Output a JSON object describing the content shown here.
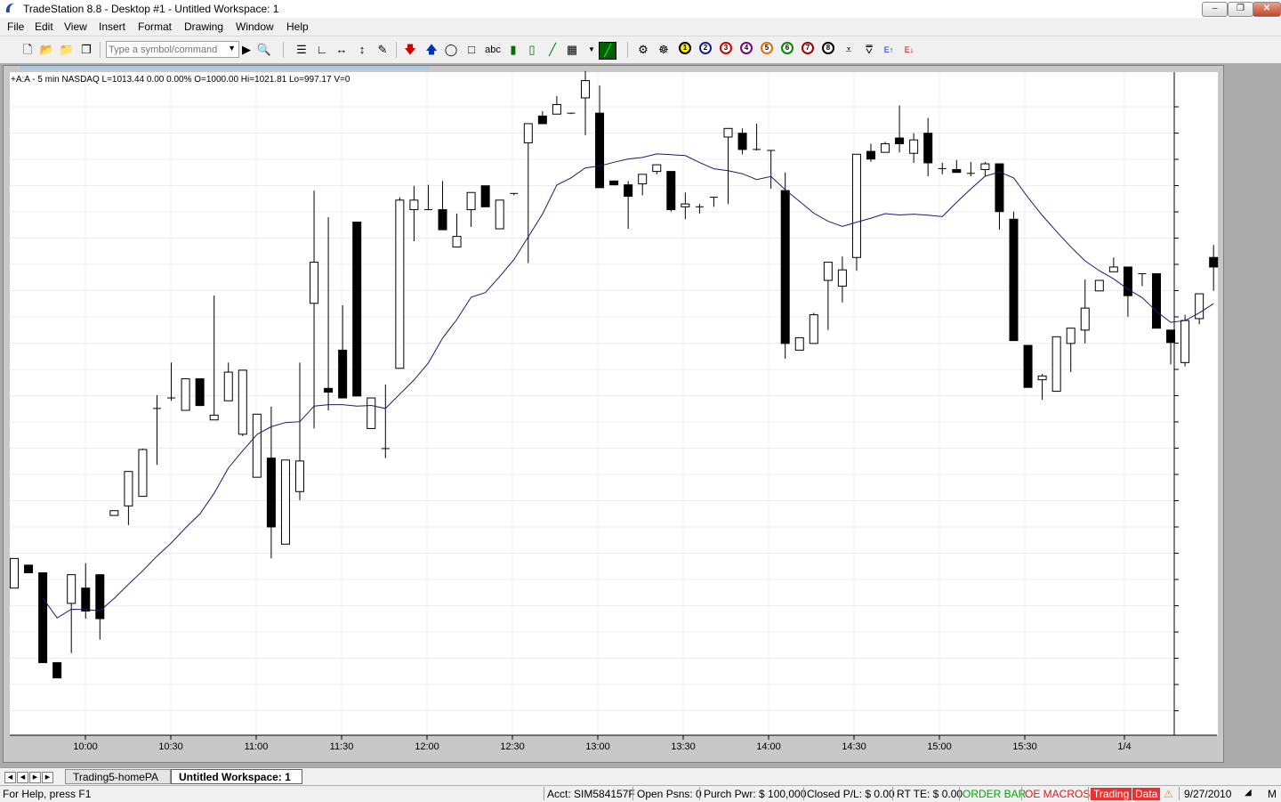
{
  "window": {
    "title": "TradeStation 8.8 - Desktop #1 - Untitled Workspace: 1",
    "min_label": "–",
    "max_label": "❐",
    "close_label": "✕"
  },
  "menu": [
    "File",
    "Edit",
    "View",
    "Insert",
    "Format",
    "Drawing",
    "Window",
    "Help"
  ],
  "toolbar": {
    "symbol_placeholder": "Type a symbol/command",
    "circle_buttons": [
      "1",
      "2",
      "3",
      "4",
      "5",
      "6",
      "7",
      "8"
    ],
    "abc_label": "abc"
  },
  "chart": {
    "info": "+A:A - 5 min  NASDAQ  L=1013.44  0.00  0.00%  O=1000.00  Hi=1021.81  Lo=997.17  V=0",
    "time_labels": [
      "10:00",
      "10:30",
      "11:00",
      "11:30",
      "12:00",
      "12:30",
      "13:00",
      "13:30",
      "14:00",
      "14:30",
      "15:00",
      "15:30",
      "1/4"
    ]
  },
  "chart_data": {
    "type": "candlestick",
    "interval": "5 min",
    "symbol": "+A:A",
    "exchange": "NASDAQ",
    "last": 1013.44,
    "open": 1000.0,
    "high": 1021.81,
    "low": 997.17,
    "bars": [
      [
        970.4,
        973.5,
        969.0,
        970.4
      ],
      [
        972.8,
        972.0,
        968.8,
        972.2
      ],
      [
        972.0,
        962.6,
        957.6,
        973.2
      ],
      [
        962.6,
        961.0,
        961.0,
        964.5
      ],
      [
        968.8,
        971.8,
        965.5,
        963.6
      ],
      [
        970.4,
        968.0,
        973.0,
        967.2
      ],
      [
        971.8,
        967.2,
        970.0,
        965.0
      ],
      [
        978.0,
        978.5,
        977.0,
        978.0
      ],
      [
        979.0,
        982.6,
        979.0,
        977.0
      ],
      [
        980.0,
        984.9,
        985.0,
        980.0
      ],
      [
        989.2,
        989.2,
        990.6,
        983.3
      ],
      [
        990.0,
        990.3,
        994.0,
        990.0
      ],
      [
        989.0,
        992.3,
        992.0,
        989.0
      ],
      [
        992.3,
        989.5,
        992.2,
        992.3
      ],
      [
        988.0,
        988.5,
        1001.0,
        988.0
      ],
      [
        990.0,
        993.0,
        994.0,
        990.0
      ],
      [
        986.5,
        993.2,
        987.8,
        986.3
      ],
      [
        982.0,
        988.6,
        986.5,
        982.0
      ],
      [
        984.0,
        976.8,
        989.4,
        973.5
      ],
      [
        975.0,
        983.8,
        983.4,
        977.2
      ],
      [
        980.5,
        983.7,
        994.0,
        979.6
      ],
      [
        1000.2,
        1004.5,
        1012.0,
        987.1
      ],
      [
        991.3,
        990.9,
        1009.2,
        989.0
      ],
      [
        995.3,
        990.3,
        1000.0,
        992.3
      ],
      [
        1008.7,
        990.5,
        1008.7,
        992.3
      ],
      [
        987.1,
        990.3,
        989.8,
        987.1
      ],
      [
        985.0,
        984.7,
        991.7,
        984.0
      ],
      [
        993.4,
        1011.0,
        1011.3,
        993.4
      ],
      [
        1010.0,
        1011.0,
        1012.5,
        1006.7
      ],
      [
        1010.0,
        1010.0,
        1012.6,
        1010.0
      ],
      [
        1010.0,
        1007.9,
        1013.0,
        1009.8
      ],
      [
        1006.1,
        1007.2,
        1009.6,
        1006.6
      ],
      [
        1010.0,
        1011.8,
        1009.8,
        1008.2
      ],
      [
        1012.5,
        1010.3,
        1008.7,
        1012.5
      ],
      [
        1008.0,
        1011.0,
        1010.0,
        1008.5
      ],
      [
        1011.5,
        1011.7,
        1009.3,
        1011.5
      ],
      [
        1017.0,
        1019.0,
        1016.5,
        1004.4
      ],
      [
        1019.8,
        1019.0,
        1020.3,
        1019.2
      ],
      [
        1020.0,
        1021.0,
        1021.9,
        1020.2
      ],
      [
        1020.0,
        1020.1,
        1019.5,
        1020.0
      ],
      [
        1021.7,
        1023.5,
        1024.5,
        1017.8
      ],
      [
        1020.1,
        1012.3,
        1023.0,
        1012.3
      ],
      [
        1013.0,
        1012.6,
        1012.6,
        1013.0
      ],
      [
        1012.6,
        1011.4,
        1013.0,
        1008.0
      ],
      [
        1012.7,
        1013.7,
        1012.5,
        1011.5
      ],
      [
        1014.0,
        1014.7,
        1013.7,
        1013.7
      ],
      [
        1014.0,
        1010.0,
        1014.0,
        1009.8
      ],
      [
        1010.3,
        1010.6,
        1011.8,
        1009.0
      ],
      [
        1010.0,
        1010.3,
        1010.6,
        1009.6
      ],
      [
        1011.3,
        1011.2,
        1009.6,
        1010.3
      ],
      [
        1017.6,
        1018.5,
        1011.8,
        1010.6
      ],
      [
        1018.0,
        1016.3,
        1018.5,
        1015.8
      ],
      [
        1016.3,
        1016.2,
        1019.0,
        1018.0
      ],
      [
        1016.0,
        1016.2,
        1013.1,
        1012.2
      ],
      [
        1012.0,
        996.0,
        1013.9,
        994.4
      ],
      [
        995.3,
        996.6,
        996.6,
        995.5
      ],
      [
        996.0,
        999.0,
        999.2,
        999.0
      ],
      [
        1002.6,
        1004.5,
        1004.5,
        997.4
      ],
      [
        1002.0,
        1003.7,
        1005.1,
        1000.3
      ],
      [
        1005.0,
        1015.8,
        1015.6,
        1003.6
      ],
      [
        1016.1,
        1015.3,
        1016.9,
        1015.0
      ],
      [
        1016.0,
        1016.9,
        1017.1,
        1016.0
      ],
      [
        1017.5,
        1016.9,
        1020.9,
        1016.0
      ],
      [
        1015.9,
        1017.3,
        1018.0,
        1014.9
      ],
      [
        1018.0,
        1014.9,
        1019.6,
        1013.5
      ],
      [
        1014.2,
        1014.3,
        1014.9,
        1013.7
      ],
      [
        1014.2,
        1013.9,
        1015.2,
        1014.0
      ],
      [
        1013.8,
        1013.7,
        1015.0,
        1013.5
      ],
      [
        1014.2,
        1014.8,
        1015.0,
        1013.5
      ],
      [
        1014.8,
        1009.8,
        1013.8,
        1007.9
      ],
      [
        1009.0,
        996.3,
        1009.8,
        996.3
      ],
      [
        995.8,
        991.4,
        995.8,
        992.3
      ],
      [
        992.2,
        992.6,
        992.8,
        990.1
      ],
      [
        991.0,
        996.7,
        996.7,
        991.5
      ],
      [
        996.0,
        997.6,
        996.6,
        993.0
      ],
      [
        997.4,
        999.7,
        1002.7,
        996.0
      ],
      [
        1001.5,
        1002.6,
        1002.6,
        1001.5
      ],
      [
        1003.5,
        1004.0,
        1005.0,
        1003.5
      ],
      [
        1004.0,
        1001.0,
        1004.0,
        998.8
      ],
      [
        1003.3,
        1003.0,
        1003.0,
        1002.0
      ],
      [
        1003.3,
        997.6,
        1002.8,
        997.6
      ],
      [
        997.4,
        996.1,
        997.4,
        993.8
      ],
      [
        994.0,
        998.4,
        999.0,
        993.6
      ],
      [
        998.6,
        1001.2,
        999.5,
        998.0
      ],
      [
        1005.0,
        1004.0,
        1006.3,
        1001.5
      ]
    ],
    "moving_average": "blue line"
  },
  "tabs": {
    "items": [
      "Trading5-homePA",
      "Untitled Workspace:  1"
    ],
    "active_index": 1
  },
  "status": {
    "help": "For Help, press F1",
    "account": "Acct: SIM584157F",
    "open_positions": "Open Psns: 0",
    "purchase_power": "Purch Pwr: $ 100,000",
    "closed_pl": "Closed P/L: $ 0.00",
    "rt_te": "RT TE: $ 0.00",
    "order_bar": "ORDER BAR",
    "oe_macros": "OE MACROS",
    "trading": "Trading",
    "data": "Data",
    "date": "9/27/2010",
    "mode": "M"
  },
  "colors": {
    "ma_line": "#1a1a70",
    "order_bar": "#00aa00",
    "oe_macros": "#d02020",
    "badge": "#e53333",
    "grid": "#ececec"
  }
}
